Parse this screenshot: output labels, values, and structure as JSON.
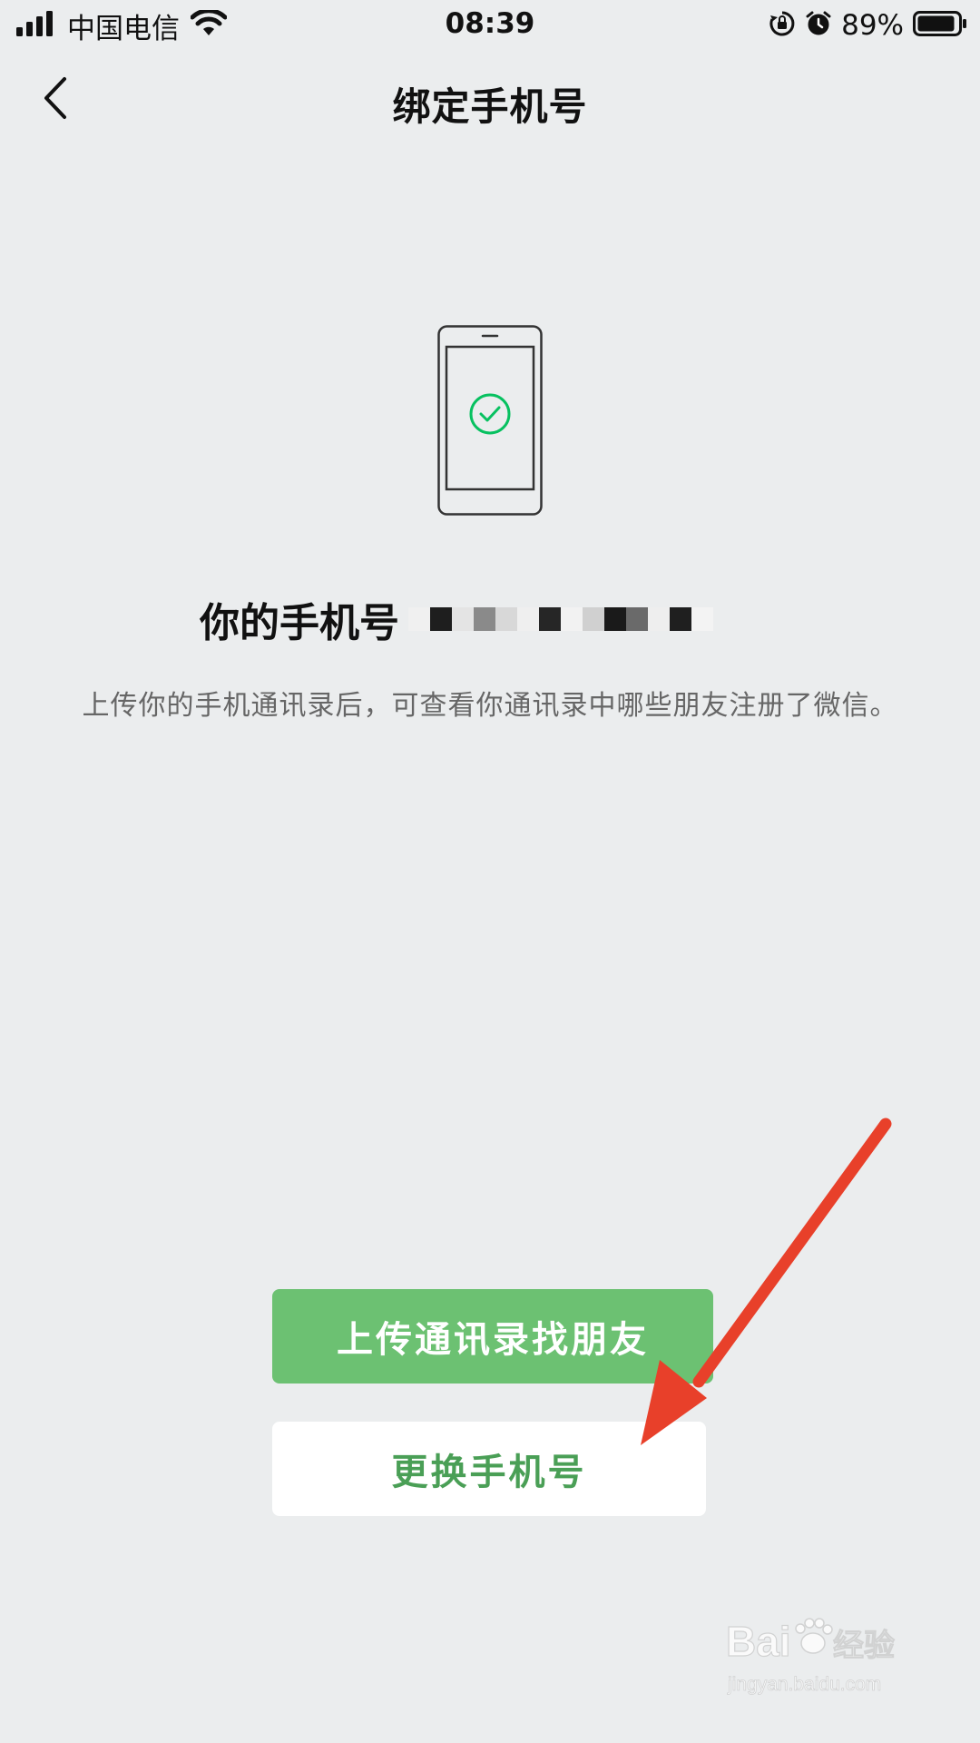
{
  "status_bar": {
    "carrier": "中国电信",
    "time": "08:39",
    "battery_percent": "89%",
    "icons": [
      "signal-icon",
      "wifi-icon",
      "rotation-lock-icon",
      "alarm-icon",
      "battery-icon"
    ]
  },
  "nav": {
    "title": "绑定手机号",
    "back_icon": "chevron-left-icon"
  },
  "content": {
    "phone_label": "你的手机号",
    "description": "上传你的手机通讯录后，可查看你通讯录中哪些朋友注册了微信。",
    "illustration_icon": "phone-check-icon",
    "accent_color": "#07c160"
  },
  "actions": {
    "upload_contacts": "上传通讯录找朋友",
    "change_number": "更换手机号"
  },
  "annotation": {
    "arrow_color": "#e8402a"
  },
  "watermark": {
    "brand": "Bai",
    "brand_suffix": "经验",
    "url": "jingyan.baidu.com"
  }
}
